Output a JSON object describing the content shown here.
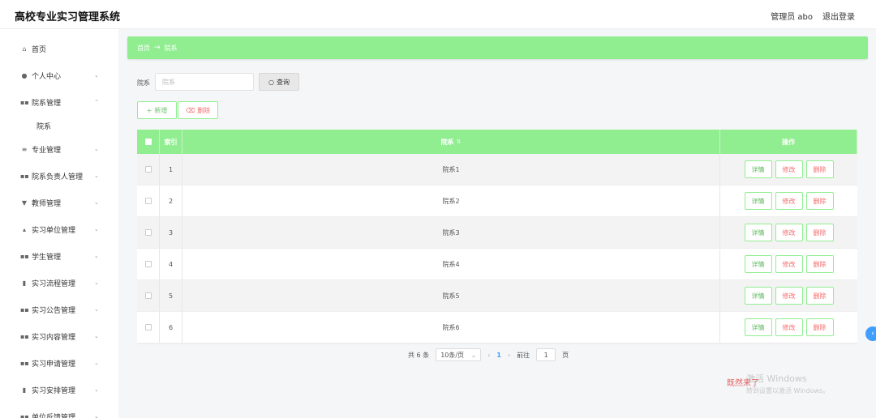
{
  "header": {
    "title": "高校专业实习管理系统",
    "user": "管理员 abo",
    "logout": "退出登录"
  },
  "sidebar": {
    "items": [
      {
        "label": "首页",
        "icon": "home-icon"
      },
      {
        "label": "个人中心",
        "icon": "user-icon"
      },
      {
        "label": "院系管理",
        "icon": "grid-icon"
      },
      {
        "label": "专业管理",
        "icon": "list-icon"
      },
      {
        "label": "院系负责人管理",
        "icon": "grid-icon"
      },
      {
        "label": "教师管理",
        "icon": "teacher-icon"
      },
      {
        "label": "实习单位管理",
        "icon": "company-icon"
      },
      {
        "label": "学生管理",
        "icon": "grid-icon"
      },
      {
        "label": "实习流程管理",
        "icon": "flow-icon"
      },
      {
        "label": "实习公告管理",
        "icon": "grid-icon"
      },
      {
        "label": "实习内容管理",
        "icon": "grid-icon"
      },
      {
        "label": "实习申请管理",
        "icon": "grid-icon"
      },
      {
        "label": "实习安排管理",
        "icon": "flow-icon"
      },
      {
        "label": "单位反馈管理",
        "icon": "grid-icon"
      }
    ],
    "submenu": {
      "label": "院系"
    }
  },
  "breadcrumb": {
    "home": "首页",
    "sep": "→",
    "current": "院系"
  },
  "search": {
    "label": "院系",
    "placeholder": "院系",
    "button": "查询"
  },
  "actions": {
    "add": "新增",
    "delete": "删除"
  },
  "table": {
    "headers": {
      "index": "索引",
      "name": "院系",
      "ops": "操作"
    },
    "rows": [
      {
        "index": "1",
        "name": "院系1"
      },
      {
        "index": "2",
        "name": "院系2"
      },
      {
        "index": "3",
        "name": "院系3"
      },
      {
        "index": "4",
        "name": "院系4"
      },
      {
        "index": "5",
        "name": "院系5"
      },
      {
        "index": "6",
        "name": "院系6"
      }
    ],
    "op_labels": {
      "detail": "详情",
      "edit": "修改",
      "delete": "删除"
    }
  },
  "pagination": {
    "total": "共 6 条",
    "page_size": "10条/页",
    "current": "1",
    "goto_prefix": "前往",
    "goto_value": "1",
    "goto_suffix": "页"
  },
  "watermark": {
    "red_text": "既然来了",
    "line1": "激活 Windows",
    "line2": "转到设置以激活 Windows。"
  },
  "colors": {
    "accent": "#90ee90",
    "danger": "#f56c6c",
    "link": "#409eff"
  }
}
